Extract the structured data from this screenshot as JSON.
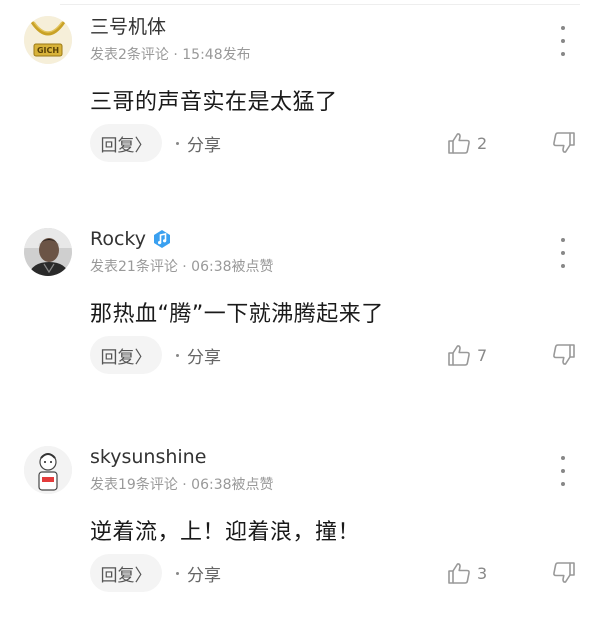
{
  "comments": [
    {
      "username": "三号机体",
      "meta": "发表2条评论 · 15:48发布",
      "text": "三哥的声音实在是太猛了",
      "reply_label": "回复〉",
      "share_label": "分享",
      "likes": "2",
      "has_badge": false,
      "avatar": "gold-chain-avatar"
    },
    {
      "username": "Rocky",
      "meta": "发表21条评论 · 06:38被点赞",
      "text": "那热血“腾”一下就沸腾起来了",
      "reply_label": "回复〉",
      "share_label": "分享",
      "likes": "7",
      "has_badge": true,
      "badge_color": "#3aa0f0",
      "avatar": "person-photo-avatar"
    },
    {
      "username": "skysunshine",
      "meta": "发表19条评论 · 06:38被点赞",
      "text": "逆着流，上！迎着浪，撞！",
      "reply_label": "回复〉",
      "share_label": "分享",
      "likes": "3",
      "has_badge": false,
      "avatar": "cartoon-figure-avatar"
    }
  ],
  "colors": {
    "meta_text": "#999999",
    "icon_gray": "#999999",
    "reply_bg": "#f4f4f4"
  }
}
